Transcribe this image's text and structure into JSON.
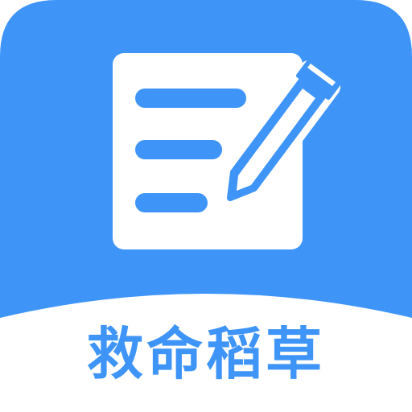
{
  "app": {
    "name": "救命稻草",
    "icon": "notepad-pencil-icon"
  },
  "colors": {
    "accent": "#3f95f7",
    "background": "#ffffff",
    "card": "#ffffff"
  }
}
